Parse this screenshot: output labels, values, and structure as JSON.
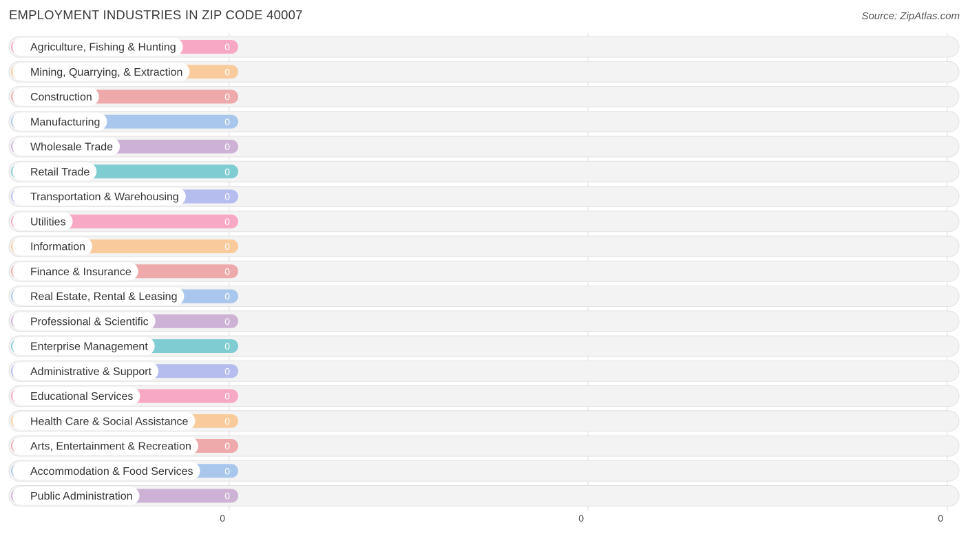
{
  "header": {
    "title": "EMPLOYMENT INDUSTRIES IN ZIP CODE 40007",
    "source": "Source: ZipAtlas.com"
  },
  "chart_data": {
    "type": "bar",
    "orientation": "horizontal",
    "title": "EMPLOYMENT INDUSTRIES IN ZIP CODE 40007",
    "categories": [
      "Agriculture, Fishing & Hunting",
      "Mining, Quarrying, & Extraction",
      "Construction",
      "Manufacturing",
      "Wholesale Trade",
      "Retail Trade",
      "Transportation & Warehousing",
      "Utilities",
      "Information",
      "Finance & Insurance",
      "Real Estate, Rental & Leasing",
      "Professional & Scientific",
      "Enterprise Management",
      "Administrative & Support",
      "Educational Services",
      "Health Care & Social Assistance",
      "Arts, Entertainment & Recreation",
      "Accommodation & Food Services",
      "Public Administration"
    ],
    "values": [
      0,
      0,
      0,
      0,
      0,
      0,
      0,
      0,
      0,
      0,
      0,
      0,
      0,
      0,
      0,
      0,
      0,
      0,
      0
    ],
    "value_labels": [
      "0",
      "0",
      "0",
      "0",
      "0",
      "0",
      "0",
      "0",
      "0",
      "0",
      "0",
      "0",
      "0",
      "0",
      "0",
      "0",
      "0",
      "0",
      "0"
    ],
    "colors": [
      "#f7a8c4",
      "#f9cb9c",
      "#eeaaaa",
      "#a9c7ec",
      "#cdb2d6",
      "#7fcdd2",
      "#b5bdee",
      "#f7a8c4",
      "#f9cb9c",
      "#eeaaaa",
      "#a9c7ec",
      "#cdb2d6",
      "#7fcdd2",
      "#b5bdee",
      "#f7a8c4",
      "#f9cb9c",
      "#eeaaaa",
      "#a9c7ec",
      "#cdb2d6"
    ],
    "x_ticks": [
      "0",
      "0",
      "0"
    ],
    "grid": true
  }
}
